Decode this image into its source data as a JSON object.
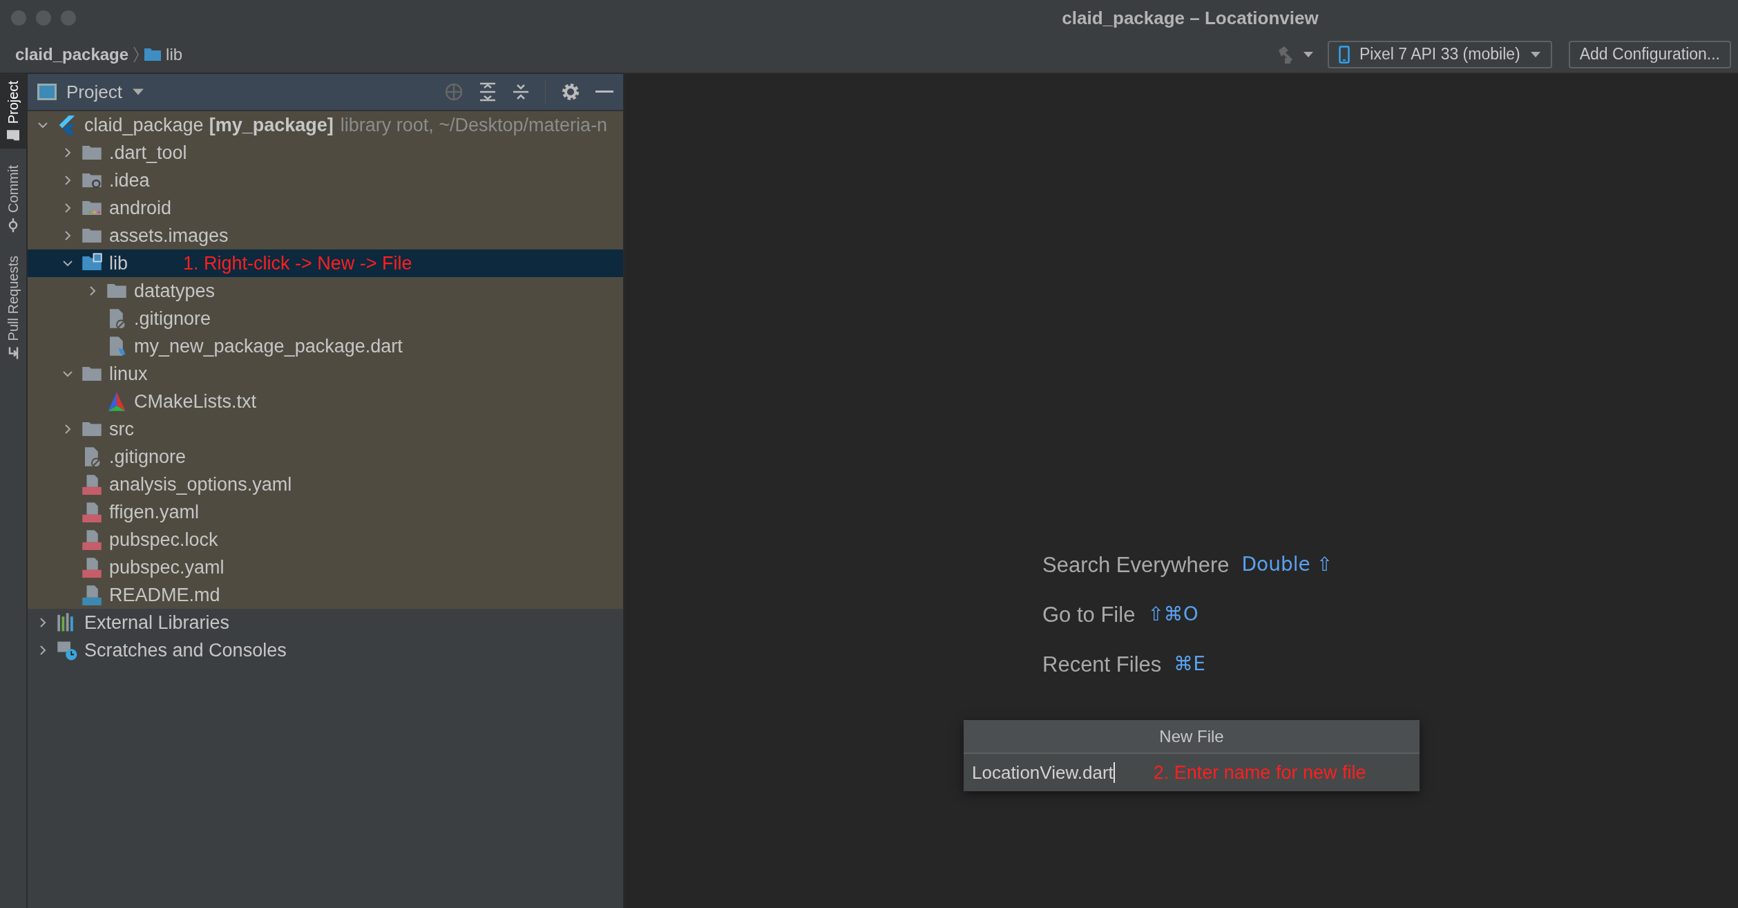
{
  "window": {
    "title": "claid_package – Locationview"
  },
  "breadcrumb": [
    {
      "label": "claid_package",
      "kind": "project"
    },
    {
      "label": "lib",
      "kind": "folder"
    }
  ],
  "toolbar": {
    "device": "Pixel 7 API 33 (mobile)",
    "config_button": "Add Configuration..."
  },
  "tool_stripe": [
    {
      "label": "Project",
      "kind": "project",
      "selected": true
    },
    {
      "label": "Commit",
      "kind": "commit",
      "selected": false
    },
    {
      "label": "Pull Requests",
      "kind": "pull",
      "selected": false
    }
  ],
  "project_panel": {
    "title": "Project",
    "tree": [
      {
        "label": "claid_package",
        "module": "[my_package]",
        "note": "library root, ~/Desktop/materia-n",
        "kind": "flutter",
        "expanded": true,
        "selected": false,
        "scoped": true,
        "children": [
          {
            "label": ".dart_tool",
            "kind": "folder",
            "expanded": false,
            "selected": false
          },
          {
            "label": ".idea",
            "kind": "idea",
            "expanded": false,
            "selected": false
          },
          {
            "label": "android",
            "kind": "android",
            "expanded": false,
            "selected": false
          },
          {
            "label": "assets.images",
            "kind": "folder",
            "expanded": false,
            "selected": false
          },
          {
            "label": "lib",
            "kind": "lib",
            "expanded": true,
            "selected": true,
            "annotation": "1. Right-click -> New -> File",
            "children": [
              {
                "label": "datatypes",
                "kind": "folder",
                "expanded": false,
                "selected": false
              },
              {
                "label": ".gitignore",
                "kind": "ignore",
                "selected": false
              },
              {
                "label": "my_new_package_package.dart",
                "kind": "dart",
                "selected": false
              }
            ]
          },
          {
            "label": "linux",
            "kind": "folder",
            "expanded": true,
            "selected": false,
            "children": [
              {
                "label": "CMakeLists.txt",
                "kind": "cmake",
                "selected": false
              }
            ]
          },
          {
            "label": "src",
            "kind": "folder",
            "expanded": false,
            "selected": false
          },
          {
            "label": ".gitignore",
            "kind": "ignore",
            "selected": false
          },
          {
            "label": "analysis_options.yaml",
            "kind": "yaml",
            "selected": false
          },
          {
            "label": "ffigen.yaml",
            "kind": "yaml",
            "selected": false
          },
          {
            "label": "pubspec.lock",
            "kind": "yaml",
            "selected": false
          },
          {
            "label": "pubspec.yaml",
            "kind": "yaml",
            "selected": false
          },
          {
            "label": "README.md",
            "kind": "md",
            "selected": false
          }
        ]
      },
      {
        "label": "External Libraries",
        "kind": "libraries",
        "expanded": false,
        "selected": false,
        "scoped": false
      },
      {
        "label": "Scratches and Consoles",
        "kind": "scratches",
        "expanded": false,
        "selected": false,
        "scoped": false
      }
    ]
  },
  "editor": {
    "hints": [
      {
        "label": "Search Everywhere",
        "shortcut": "Double ⇧"
      },
      {
        "label": "Go to File",
        "shortcut": "⇧⌘O"
      },
      {
        "label": "Recent Files",
        "shortcut": "⌘E"
      }
    ]
  },
  "new_file_dialog": {
    "title": "New File",
    "value": "LocationView.dart",
    "annotation": "2. Enter name for new file"
  }
}
